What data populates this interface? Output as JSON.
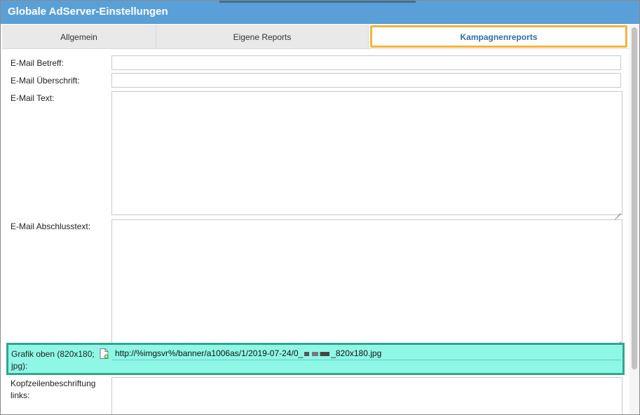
{
  "window": {
    "title": "Globale AdServer-Einstellungen"
  },
  "tabs": [
    {
      "label": "Allgemein",
      "active": false
    },
    {
      "label": "Eigene Reports",
      "active": false
    },
    {
      "label": "Kampagnenreports",
      "active": true
    }
  ],
  "form": {
    "email_subject": {
      "label": "E-Mail Betreff:",
      "value": ""
    },
    "email_heading": {
      "label": "E-Mail Überschrift:",
      "value": ""
    },
    "email_text": {
      "label": "E-Mail Text:",
      "value": ""
    },
    "email_closing": {
      "label": "E-Mail Abschlusstext:",
      "value": ""
    },
    "top_graphic": {
      "label": "Grafik oben (820x180; jpg):",
      "value_prefix": "http://%imgsvr%/banner/a1006as/1/2019-07-24/0_",
      "value_suffix": "_820x180.jpg",
      "icon": "file-add-icon"
    },
    "header_left": {
      "label": "Kopfzeilenbeschriftung links:",
      "value": ""
    }
  },
  "colors": {
    "titlebar": "#5aa0d8",
    "active_tab_text": "#2f6fa8",
    "tab_highlight": "#f3b43b",
    "row_highlight": "#8ff7e6",
    "row_highlight_border": "#34a58f"
  }
}
